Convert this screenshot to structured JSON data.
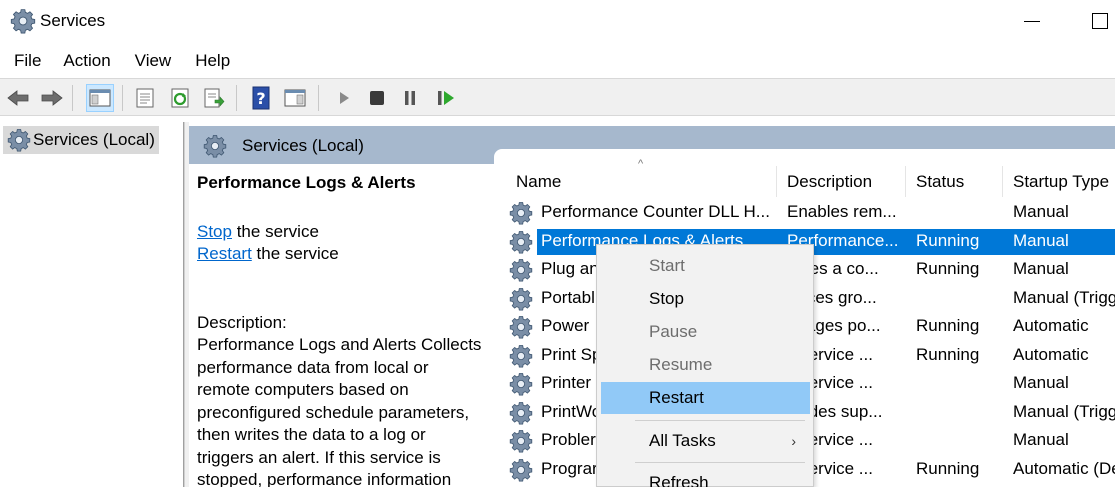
{
  "window": {
    "title": "Services",
    "icon": "gear-icon"
  },
  "menu": [
    "File",
    "Action",
    "View",
    "Help"
  ],
  "toolbar": {
    "buttons": [
      "back-arrow-icon",
      "forward-arrow-icon",
      "show-hide-console-tree-icon",
      "properties-icon",
      "refresh-icon",
      "export-list-icon",
      "help-icon",
      "action-pane-icon",
      "start-service-icon",
      "stop-service-icon",
      "pause-service-icon",
      "restart-service-icon"
    ]
  },
  "tree": {
    "selected": "Services (Local)"
  },
  "header": {
    "title": "Services (Local)"
  },
  "details": {
    "service_name": "Performance Logs & Alerts",
    "stop_link": "Stop",
    "stop_suffix": " the service",
    "restart_link": "Restart",
    "restart_suffix": " the service",
    "description_label": "Description:",
    "description_lines": [
      "Performance Logs and Alerts Collects",
      "performance data from local or",
      "remote computers based on",
      "preconfigured schedule parameters,",
      "then writes the data to a log or",
      "triggers an alert. If this service is",
      "stopped, performance information"
    ]
  },
  "columns": [
    "Name",
    "Description",
    "Status",
    "Startup Type"
  ],
  "rows": [
    {
      "name": "Performance Counter DLL H...",
      "description": "Enables rem...",
      "status": "",
      "startup": "Manual"
    },
    {
      "name": "Performance Logs & Alerts",
      "description": "Performance...",
      "status": "Running",
      "startup": "Manual",
      "selected": true
    },
    {
      "name": "Plug an",
      "description": "ables a co...",
      "status": "Running",
      "startup": "Manual"
    },
    {
      "name": "Portabl",
      "description": "forces gro...",
      "status": "",
      "startup": "Manual (Trigg"
    },
    {
      "name": "Power",
      "description": "anages po...",
      "status": "Running",
      "startup": "Automatic"
    },
    {
      "name": "Print Sp",
      "description": "s service ...",
      "status": "Running",
      "startup": "Automatic"
    },
    {
      "name": "Printer",
      "description": "s service ...",
      "status": "",
      "startup": "Manual"
    },
    {
      "name": "PrintWo",
      "description": "ovides sup...",
      "status": "",
      "startup": "Manual (Trigg"
    },
    {
      "name": "Probler",
      "description": "s service ...",
      "status": "",
      "startup": "Manual"
    },
    {
      "name": "Prograr",
      "description": "s service ...",
      "status": "Running",
      "startup": "Automatic (De"
    }
  ],
  "context_menu": {
    "items": [
      {
        "label": "Start",
        "disabled": true
      },
      {
        "label": "Stop",
        "disabled": false
      },
      {
        "label": "Pause",
        "disabled": true
      },
      {
        "label": "Resume",
        "disabled": true
      },
      {
        "label": "Restart",
        "disabled": false,
        "highlighted": true
      },
      {
        "label": "All Tasks",
        "disabled": false,
        "submenu": true
      },
      {
        "label": "Refresh",
        "disabled": false
      }
    ]
  },
  "colors": {
    "selection": "#0078d7",
    "menu_highlight": "#91c9f7",
    "pane_header": "#a6b8cd",
    "link": "#0066cc"
  }
}
